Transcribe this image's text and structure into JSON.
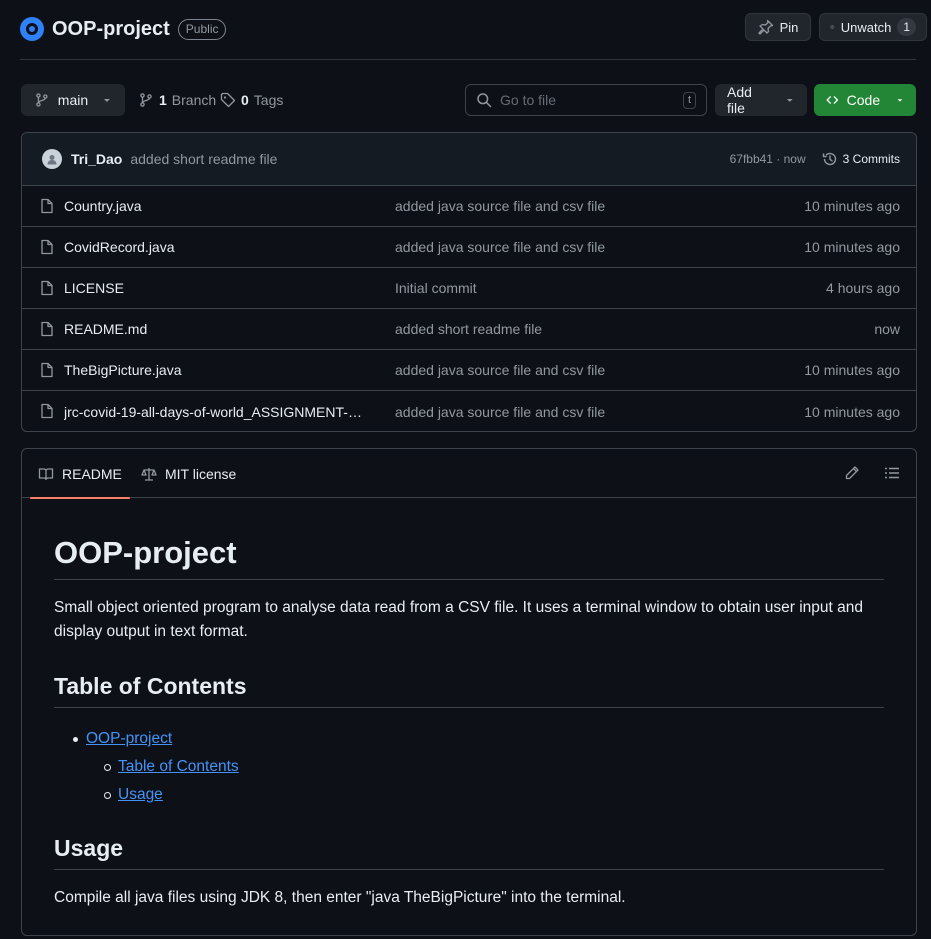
{
  "repo": {
    "name": "OOP-project",
    "visibility": "Public"
  },
  "header_actions": {
    "pin": "Pin",
    "unwatch": "Unwatch",
    "watch_count": "1"
  },
  "branch_bar": {
    "branch": "main",
    "branch_count": "1",
    "branch_label": "Branch",
    "tag_count": "0",
    "tag_label": "Tags",
    "goto_placeholder": "Go to file",
    "goto_shortcut": "t",
    "add_file": "Add file",
    "code": "Code"
  },
  "latest_commit": {
    "author": "Tri_Dao",
    "message": "added short readme file",
    "sha_time": "67fbb41 · now",
    "commits": "3 Commits"
  },
  "files": [
    {
      "name": "Country.java",
      "message": "added java source file and csv file",
      "time": "10 minutes ago"
    },
    {
      "name": "CovidRecord.java",
      "message": "added java source file and csv file",
      "time": "10 minutes ago"
    },
    {
      "name": "LICENSE",
      "message": "Initial commit",
      "time": "4 hours ago"
    },
    {
      "name": "README.md",
      "message": "added short readme file",
      "time": "now"
    },
    {
      "name": "TheBigPicture.java",
      "message": "added java source file and csv file",
      "time": "10 minutes ago"
    },
    {
      "name": "jrc-covid-19-all-days-of-world_ASSIGNMENT-F...",
      "message": "added java source file and csv file",
      "time": "10 minutes ago"
    }
  ],
  "readme": {
    "tabs": {
      "readme": "README",
      "license": "MIT license"
    },
    "title": "OOP-project",
    "intro": "Small object oriented program to analyse data read from a CSV file. It uses a terminal window to obtain user input and display output in text format.",
    "toc_heading": "Table of Contents",
    "toc": {
      "root": "OOP-project",
      "sub1": "Table of Contents",
      "sub2": "Usage"
    },
    "usage_heading": "Usage",
    "usage_text": "Compile all java files using JDK 8, then enter \"java TheBigPicture\" into the terminal."
  },
  "colors": {
    "accent_green": "#238636",
    "link": "#4493f8",
    "tab_underline": "#f78166",
    "background": "#0d1117"
  },
  "icons": [
    "repo-avatar-icon",
    "pin-icon",
    "eye-icon",
    "branch-icon",
    "tag-icon",
    "search-icon",
    "caret-down-icon",
    "code-icon",
    "history-icon",
    "file-icon",
    "book-icon",
    "law-icon",
    "pencil-icon",
    "list-icon"
  ]
}
